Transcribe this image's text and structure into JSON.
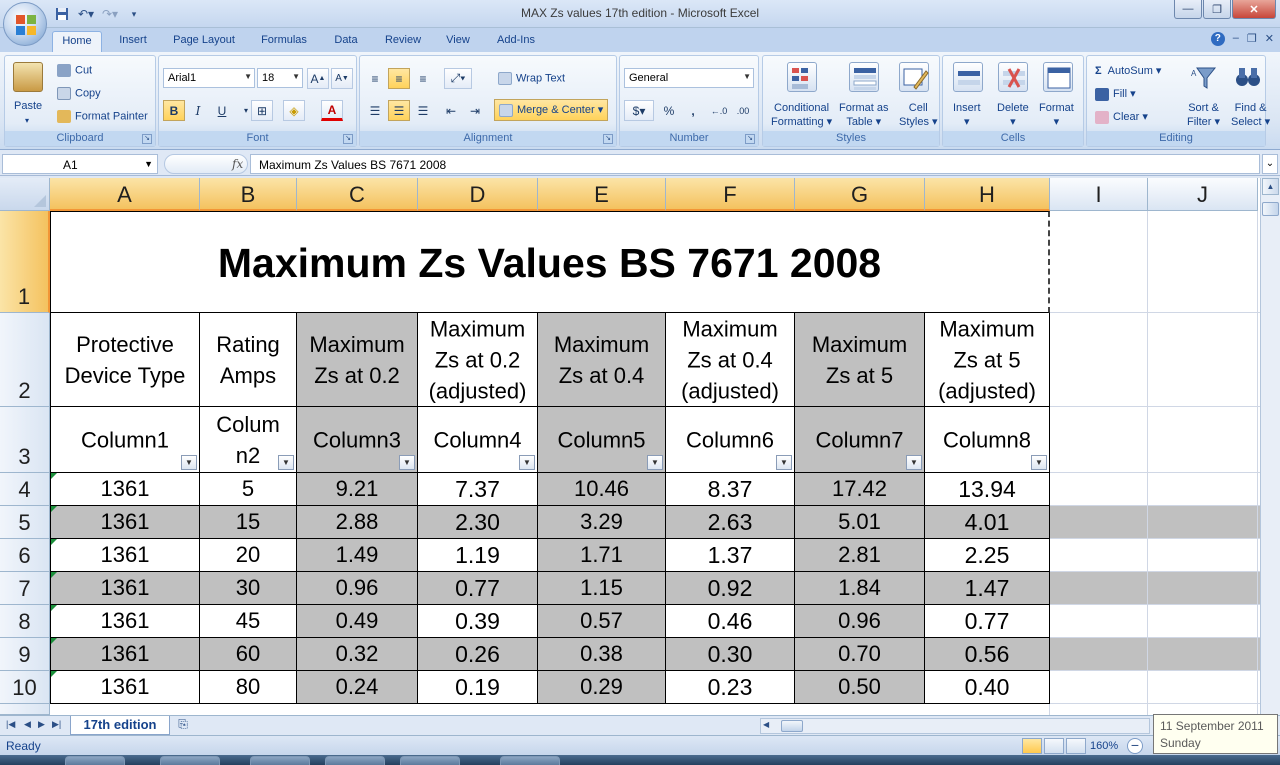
{
  "window": {
    "title": "MAX Zs values 17th edition - Microsoft Excel"
  },
  "ribbon": {
    "tabs": [
      "Home",
      "Insert",
      "Page Layout",
      "Formulas",
      "Data",
      "Review",
      "View",
      "Add-Ins"
    ],
    "active_tab": "Home",
    "clipboard": {
      "label": "Clipboard",
      "paste": "Paste",
      "cut": "Cut",
      "copy": "Copy",
      "format_painter": "Format Painter"
    },
    "font": {
      "label": "Font",
      "name": "Arial1",
      "size": "18",
      "bold": "B",
      "italic": "I",
      "underline": "U"
    },
    "alignment": {
      "label": "Alignment",
      "wrap_text": "Wrap Text",
      "merge_center": "Merge & Center"
    },
    "number": {
      "label": "Number",
      "format": "General",
      "percent": "%",
      "comma": ",",
      "inc_dec": ".00"
    },
    "styles": {
      "label": "Styles",
      "conditional_1": "Conditional",
      "conditional_2": "Formatting",
      "format_table_1": "Format as",
      "format_table_2": "Table",
      "cell_styles_1": "Cell",
      "cell_styles_2": "Styles"
    },
    "cells": {
      "label": "Cells",
      "insert": "Insert",
      "delete": "Delete",
      "format": "Format"
    },
    "editing": {
      "label": "Editing",
      "autosum": "AutoSum",
      "fill": "Fill",
      "clear": "Clear",
      "sort_1": "Sort &",
      "sort_2": "Filter",
      "find_1": "Find &",
      "find_2": "Select"
    }
  },
  "formula_bar": {
    "name_box": "A1",
    "fx": "fx",
    "content": "Maximum Zs Values BS 7671 2008"
  },
  "grid": {
    "columns": [
      "A",
      "B",
      "C",
      "D",
      "E",
      "F",
      "G",
      "H",
      "I",
      "J"
    ],
    "rows": [
      "1",
      "2",
      "3",
      "4",
      "5",
      "6",
      "7",
      "8",
      "9",
      "10"
    ],
    "title": "Maximum Zs Values BS 7671 2008",
    "header_row": [
      [
        "Protective",
        "Device Type"
      ],
      [
        "Rating",
        "Amps"
      ],
      [
        "Maximum",
        "Zs at 0.2"
      ],
      [
        "Maximum",
        "Zs at 0.2",
        "(adjusted)"
      ],
      [
        "Maximum",
        "Zs at 0.4"
      ],
      [
        "Maximum",
        "Zs at 0.4",
        "(adjusted)"
      ],
      [
        "Maximum",
        "Zs at 5"
      ],
      [
        "Maximum",
        "Zs at 5",
        "(adjusted)"
      ]
    ],
    "table_columns": [
      [
        "Column1"
      ],
      [
        "Colum",
        "n2"
      ],
      [
        "Column3"
      ],
      [
        "Column4"
      ],
      [
        "Column5"
      ],
      [
        "Column6"
      ],
      [
        "Column7"
      ],
      [
        "Column8"
      ]
    ],
    "data": [
      [
        "1361",
        "5",
        "9.21",
        "7.37",
        "10.46",
        "8.37",
        "17.42",
        "13.94"
      ],
      [
        "1361",
        "15",
        "2.88",
        "2.30",
        "3.29",
        "2.63",
        "5.01",
        "4.01"
      ],
      [
        "1361",
        "20",
        "1.49",
        "1.19",
        "1.71",
        "1.37",
        "2.81",
        "2.25"
      ],
      [
        "1361",
        "30",
        "0.96",
        "0.77",
        "1.15",
        "0.92",
        "1.84",
        "1.47"
      ],
      [
        "1361",
        "45",
        "0.49",
        "0.39",
        "0.57",
        "0.46",
        "0.96",
        "0.77"
      ],
      [
        "1361",
        "60",
        "0.32",
        "0.26",
        "0.38",
        "0.30",
        "0.70",
        "0.56"
      ],
      [
        "1361",
        "80",
        "0.24",
        "0.19",
        "0.29",
        "0.23",
        "0.50",
        "0.40"
      ]
    ]
  },
  "sheet_tabs": {
    "active": "17th edition"
  },
  "status": {
    "ready": "Ready",
    "zoom": "160%"
  },
  "date_tooltip": {
    "date": "11 September 2011",
    "day": "Sunday"
  },
  "colors": {
    "header_gray": "#c0c0c0",
    "selection": "#f4c25f",
    "ribbon_blue": "#dfe8f5"
  }
}
